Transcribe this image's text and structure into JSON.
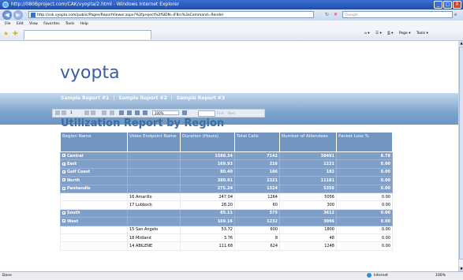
{
  "window": {
    "title": "http://080Bproject.com/CAK/vyopta/2.html - Windows Internet Explorer",
    "buttons": [
      "_",
      "□",
      "X"
    ]
  },
  "address": {
    "url": "http://vsk.vyopta.com/public/Pages/ReportViewer.aspx?%2fproject%2fSIDN=IF8rs%3aCommand=Render",
    "search_placeholder": "Google"
  },
  "menu": [
    "File",
    "Edit",
    "View",
    "Favorites",
    "Tools",
    "Help"
  ],
  "commandbar": [
    "Page ▾",
    "Tools ▾"
  ],
  "brand": {
    "logo": "vyopta"
  },
  "report_nav": [
    "Sample Report #1",
    "Sample Report #2",
    "Sample Report #3"
  ],
  "report_toolbar": {
    "page": "1",
    "zoom": "100%",
    "find": "Find",
    "next": "Next"
  },
  "report": {
    "title": "Utilization Report by Region",
    "columns": [
      "Region Name",
      "Video Endpoint Name",
      "Duration (Hours)",
      "Total Calls",
      "Number of Attendees",
      "Packet Loss %"
    ],
    "rows": [
      {
        "type": "group",
        "toggle": "+",
        "region": "Central",
        "endpoint": "",
        "duration": "1588.34",
        "calls": "7142",
        "attendees": "38491",
        "loss": "8.78"
      },
      {
        "type": "group",
        "toggle": "+",
        "region": "East",
        "endpoint": "",
        "duration": "169.93",
        "calls": "216",
        "attendees": "1221",
        "loss": "0.00"
      },
      {
        "type": "group",
        "toggle": "+",
        "region": "Gulf Coast",
        "endpoint": "",
        "duration": "80.40",
        "calls": "186",
        "attendees": "182",
        "loss": "0.00"
      },
      {
        "type": "group",
        "toggle": "+",
        "region": "North",
        "endpoint": "",
        "duration": "280.91",
        "calls": "2321",
        "attendees": "11181",
        "loss": "0.00"
      },
      {
        "type": "group",
        "toggle": "-",
        "region": "Panhandle",
        "endpoint": "",
        "duration": "275.24",
        "calls": "1324",
        "attendees": "5356",
        "loss": "0.00"
      },
      {
        "type": "detail",
        "toggle": "",
        "region": "",
        "endpoint": "16 Amarillo",
        "duration": "247.04",
        "calls": "1264",
        "attendees": "5056",
        "loss": "0.00"
      },
      {
        "type": "detail",
        "toggle": "",
        "region": "",
        "endpoint": "17 Lubbock",
        "duration": "28.20",
        "calls": "60",
        "attendees": "300",
        "loss": "0.00"
      },
      {
        "type": "group",
        "toggle": "+",
        "region": "South",
        "endpoint": "",
        "duration": "85.11",
        "calls": "575",
        "attendees": "3612",
        "loss": "0.00"
      },
      {
        "type": "group",
        "toggle": "-",
        "region": "West",
        "endpoint": "",
        "duration": "169.16",
        "calls": "1232",
        "attendees": "3096",
        "loss": "0.00"
      },
      {
        "type": "detail",
        "toggle": "",
        "region": "",
        "endpoint": "15 San Angelo",
        "duration": "53.72",
        "calls": "600",
        "attendees": "1800",
        "loss": "0.00"
      },
      {
        "type": "detail",
        "toggle": "",
        "region": "",
        "endpoint": "18 Midland",
        "duration": "3.76",
        "calls": "8",
        "attendees": "48",
        "loss": "0.00"
      },
      {
        "type": "detail",
        "toggle": "",
        "region": "",
        "endpoint": "14 ABILENE",
        "duration": "111.68",
        "calls": "624",
        "attendees": "1248",
        "loss": "0.00"
      }
    ]
  },
  "status": {
    "left": "Done",
    "zone": "Internet",
    "zoom": "100%"
  }
}
